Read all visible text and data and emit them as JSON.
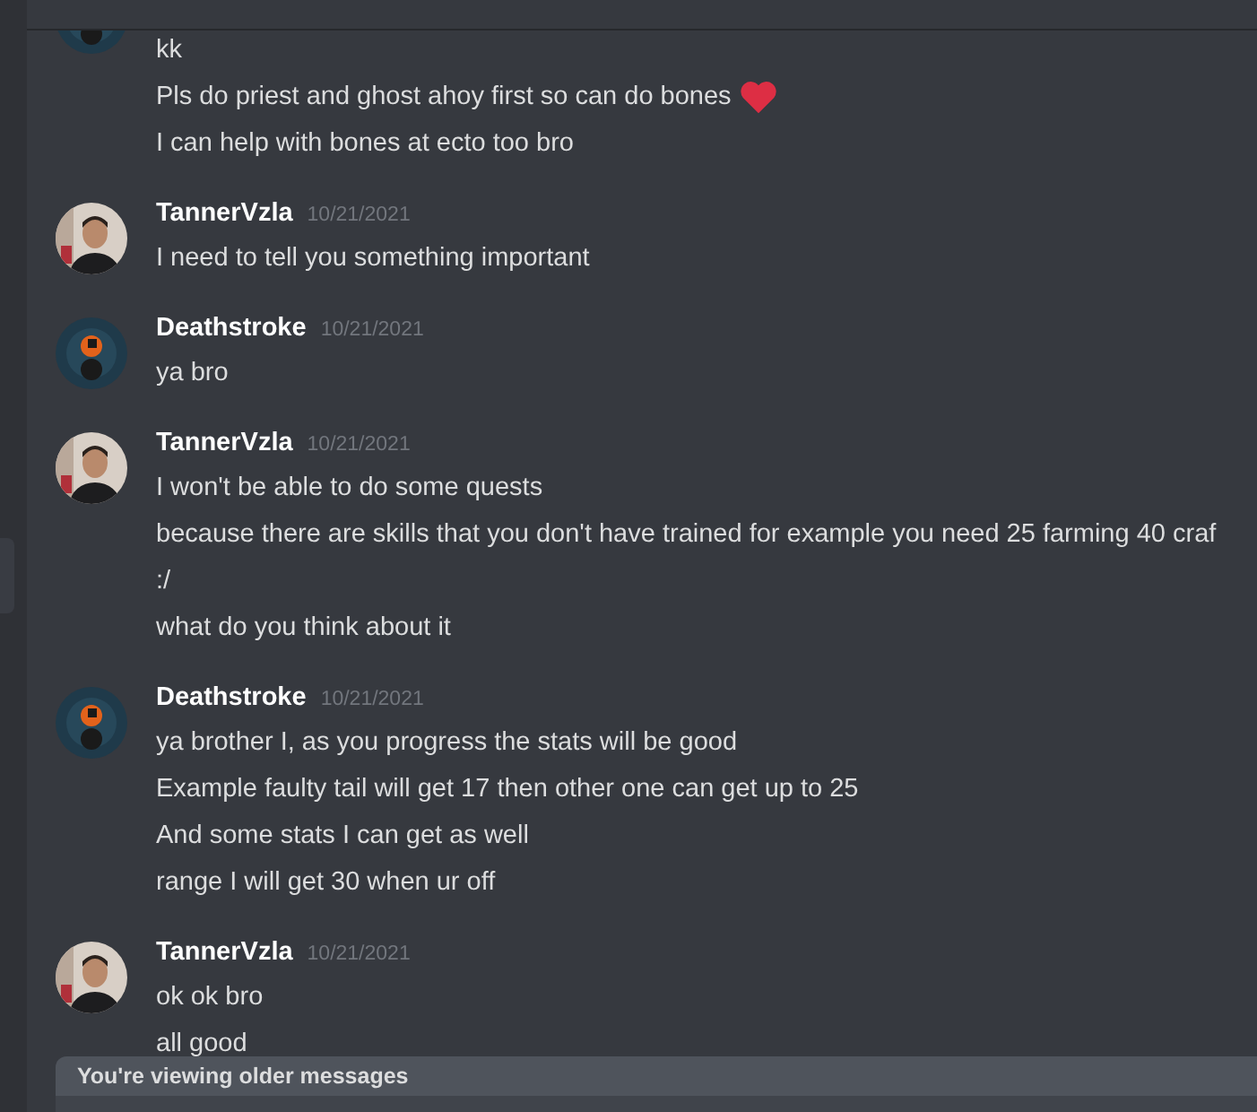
{
  "banner": {
    "text": "You're viewing older messages"
  },
  "groups": [
    {
      "messages": [
        {
          "kind": "text",
          "text": "kk"
        },
        {
          "kind": "emoji",
          "text": "Pls do priest and ghost ahoy first so can do bones"
        },
        {
          "kind": "text",
          "text": "I can help with bones at ecto too bro"
        }
      ]
    },
    {
      "author": "TannerVzla",
      "time": "10/21/2021",
      "messages": [
        {
          "kind": "text",
          "text": "I need to tell you something important"
        }
      ]
    },
    {
      "author": "Deathstroke",
      "time": "10/21/2021",
      "messages": [
        {
          "kind": "text",
          "text": "ya bro"
        }
      ]
    },
    {
      "author": "TannerVzla",
      "time": "10/21/2021",
      "messages": [
        {
          "kind": "text",
          "text": "I won't be able to do some quests"
        },
        {
          "kind": "text",
          "text": "because there are skills that you don't have trained for example you need 25 farming  40 craf"
        },
        {
          "kind": "text",
          "text": ":/"
        },
        {
          "kind": "text",
          "text": "what do you think about it"
        }
      ]
    },
    {
      "author": "Deathstroke",
      "time": "10/21/2021",
      "messages": [
        {
          "kind": "text",
          "text": "ya brother I, as you progress the stats will be good"
        },
        {
          "kind": "text",
          "text": "Example faulty tail will get 17 then other one can get up to 25"
        },
        {
          "kind": "text",
          "text": "And some stats I can get as well"
        },
        {
          "kind": "text",
          "text": "range I will get 30 when ur off"
        }
      ]
    },
    {
      "author": "TannerVzla",
      "time": "10/21/2021",
      "messages": [
        {
          "kind": "text",
          "text": "ok ok bro"
        },
        {
          "kind": "text",
          "text": "all good"
        }
      ]
    }
  ]
}
